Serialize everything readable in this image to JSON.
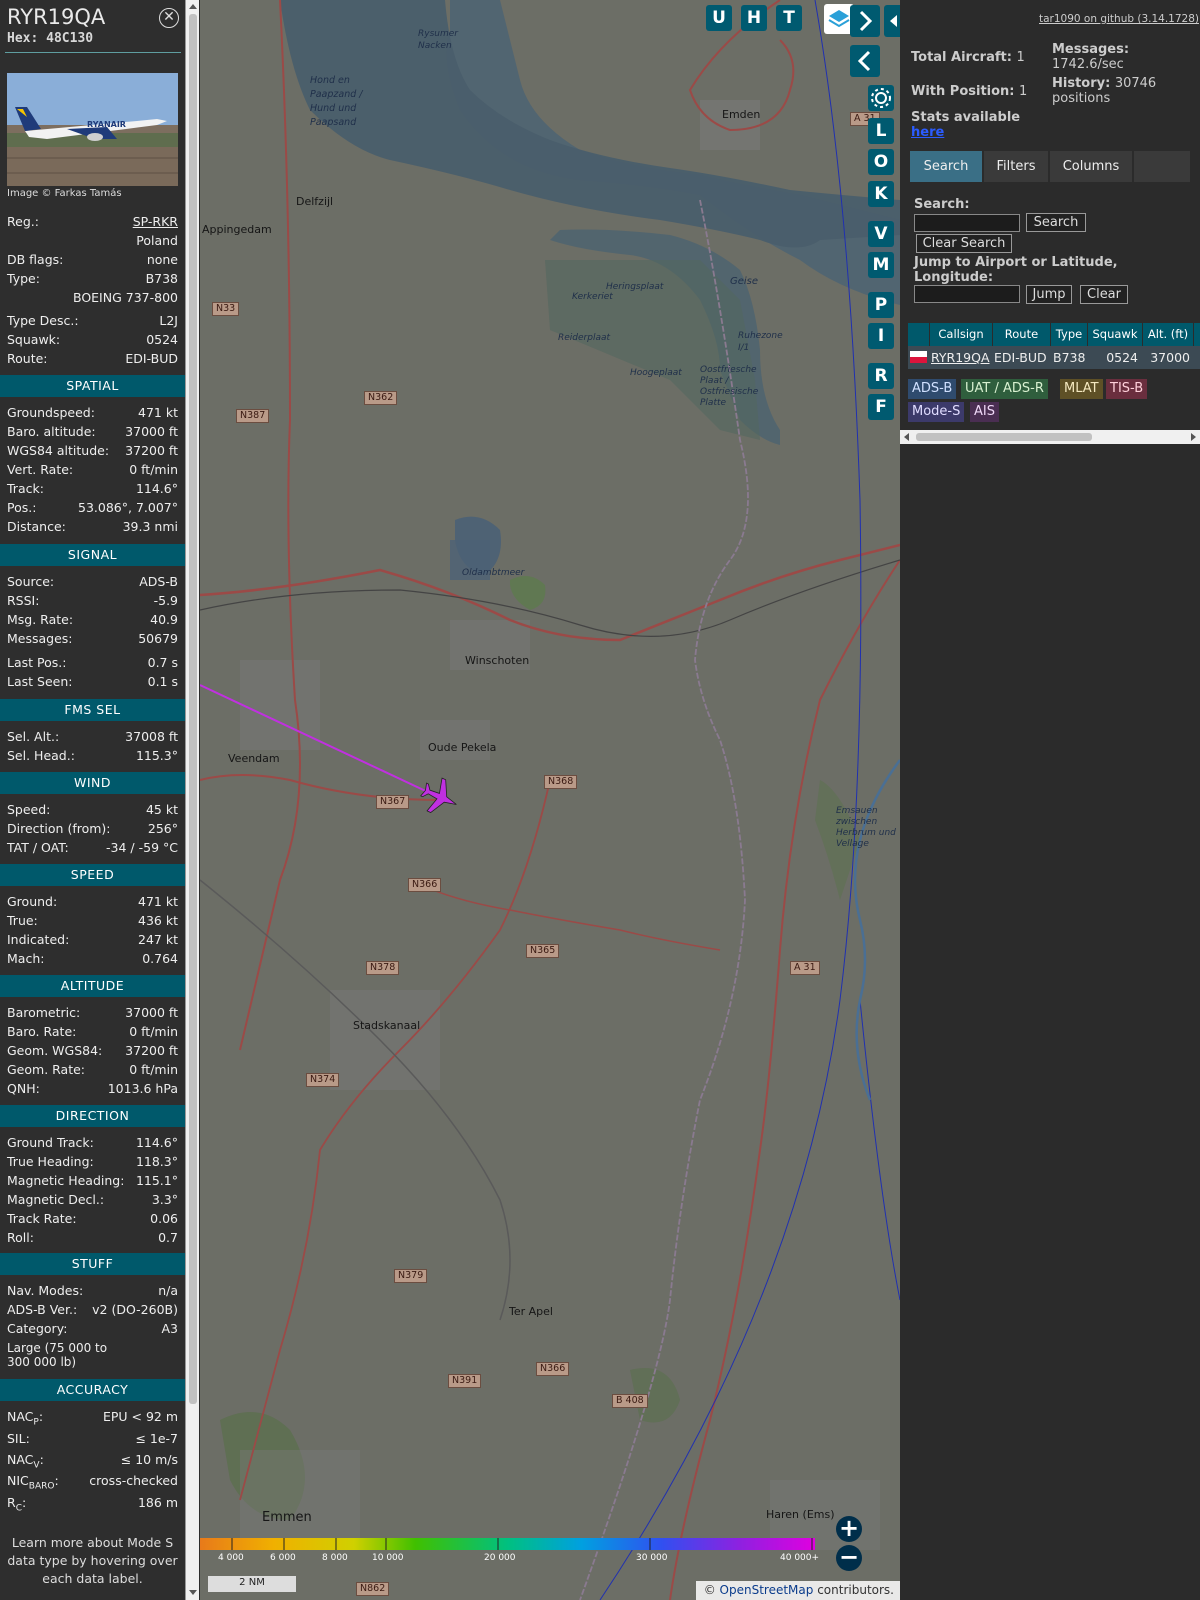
{
  "aircraft": {
    "callsign": "RYR19QA",
    "hex_label": "Hex:",
    "hex": "48C130",
    "photo_caption": "Image © Farkas Tamás",
    "photo_livery": "RYANAIR"
  },
  "info_rows": [
    {
      "k": "Reg.:",
      "v": "SP-RKR",
      "sub": "Poland"
    },
    {
      "k": "DB flags:",
      "v": "none"
    },
    {
      "k": "Type:",
      "v": "B738",
      "sub": "BOEING 737-800"
    },
    {
      "k": "Type Desc.:",
      "v": "L2J"
    },
    {
      "k": "Squawk:",
      "v": "0524"
    },
    {
      "k": "Route:",
      "v": "EDI-BUD"
    }
  ],
  "sections": {
    "spatial": "SPATIAL",
    "signal": "SIGNAL",
    "fms": "FMS SEL",
    "wind": "WIND",
    "speed": "SPEED",
    "altitude": "ALTITUDE",
    "direction": "DIRECTION",
    "stuff": "STUFF",
    "accuracy": "ACCURACY"
  },
  "spatial": [
    {
      "k": "Groundspeed:",
      "v": "471 kt"
    },
    {
      "k": "Baro. altitude:",
      "v": "37000 ft"
    },
    {
      "k": "WGS84 altitude:",
      "v": "37200 ft"
    },
    {
      "k": "Vert. Rate:",
      "v": "0 ft/min"
    },
    {
      "k": "Track:",
      "v": "114.6°"
    },
    {
      "k": "Pos.:",
      "v": "53.086°, 7.007°"
    },
    {
      "k": "Distance:",
      "v": "39.3 nmi"
    }
  ],
  "signal": [
    {
      "k": "Source:",
      "v": "ADS-B"
    },
    {
      "k": "RSSI:",
      "v": "-5.9"
    },
    {
      "k": "Msg. Rate:",
      "v": "40.9"
    },
    {
      "k": "Messages:",
      "v": "50679"
    },
    {
      "k": "Last Pos.:",
      "v": "0.7 s"
    },
    {
      "k": "Last Seen:",
      "v": "0.1 s"
    }
  ],
  "fms": [
    {
      "k": "Sel. Alt.:",
      "v": "37008 ft"
    },
    {
      "k": "Sel. Head.:",
      "v": "115.3°"
    }
  ],
  "wind": [
    {
      "k": "Speed:",
      "v": "45 kt"
    },
    {
      "k": "Direction (from):",
      "v": "256°"
    },
    {
      "k": "TAT / OAT:",
      "v": "-34 / -59 °C"
    }
  ],
  "speed": [
    {
      "k": "Ground:",
      "v": "471 kt"
    },
    {
      "k": "True:",
      "v": "436 kt"
    },
    {
      "k": "Indicated:",
      "v": "247 kt"
    },
    {
      "k": "Mach:",
      "v": "0.764"
    }
  ],
  "altitude": [
    {
      "k": "Barometric:",
      "v": "37000 ft"
    },
    {
      "k": "Baro. Rate:",
      "v": "0 ft/min"
    },
    {
      "k": "Geom. WGS84:",
      "v": "37200 ft"
    },
    {
      "k": "Geom. Rate:",
      "v": "0 ft/min"
    },
    {
      "k": "QNH:",
      "v": "1013.6 hPa"
    }
  ],
  "direction": [
    {
      "k": "Ground Track:",
      "v": "114.6°"
    },
    {
      "k": "True Heading:",
      "v": "118.3°"
    },
    {
      "k": "Magnetic Heading:",
      "v": "115.1°"
    },
    {
      "k": "Magnetic Decl.:",
      "v": "3.3°"
    },
    {
      "k": "Track Rate:",
      "v": "0.06"
    },
    {
      "k": "Roll:",
      "v": "0.7"
    }
  ],
  "stuff": [
    {
      "k": "Nav. Modes:",
      "v": "n/a"
    },
    {
      "k": "ADS-B Ver.:",
      "v": "v2 (DO-260B)"
    },
    {
      "k": "Category:",
      "v": "A3"
    }
  ],
  "stuff_category_desc": "Large (75 000 to 300 000 lb)",
  "accuracy": [
    {
      "k": "NAC",
      "sub": "P",
      "tail": ":",
      "v": "EPU < 92 m"
    },
    {
      "k": "SIL:",
      "sub": "",
      "tail": "",
      "v": "≤ 1e-7"
    },
    {
      "k": "NAC",
      "sub": "V",
      "tail": ":",
      "v": "≤ 10 m/s"
    },
    {
      "k": "NIC",
      "sub": "BARO",
      "tail": ":",
      "v": "cross-checked"
    },
    {
      "k": "R",
      "sub": "C",
      "tail": ":",
      "v": "186 m"
    }
  ],
  "footer_note": "Learn more about Mode S data type by hovering over each data label.",
  "map": {
    "buttons_top": [
      "U",
      "H",
      "T"
    ],
    "side_buttons": [
      "L",
      "O",
      "K",
      "V",
      "M",
      "P",
      "I",
      "R",
      "F"
    ],
    "places": [
      {
        "n": "Emden"
      },
      {
        "n": "Delfzijl"
      },
      {
        "n": "Appingedam"
      },
      {
        "n": "Winschoten"
      },
      {
        "n": "Oude Pekela"
      },
      {
        "n": "Veendam"
      },
      {
        "n": "Stadskanaal"
      },
      {
        "n": "Ter Apel"
      },
      {
        "n": "Emmen"
      },
      {
        "n": "Haren (Ems)"
      },
      {
        "n": "Oldambtmeer"
      },
      {
        "n": "Geise"
      },
      {
        "n": "Rysumer Nacken"
      },
      {
        "n": "Hond en Paapzand / Hund und Paapsand"
      },
      {
        "n": "Ruhezone I/1"
      },
      {
        "n": "Heringsplaat"
      },
      {
        "n": "Kerkeriet"
      },
      {
        "n": "Reiderplaat"
      },
      {
        "n": "Hoogeplaat"
      },
      {
        "n": "Oostfriesche Plaat / Ostfriesische Platte"
      },
      {
        "n": "Emsauen zwischen Herbrum und Vellage"
      }
    ],
    "roads": [
      "N33",
      "N387",
      "N362",
      "N367",
      "N368",
      "N366",
      "N365",
      "N378",
      "N374",
      "N379",
      "N391",
      "N366",
      "N862",
      "A 31",
      "A 31",
      "B 408"
    ],
    "altitude_scale": [
      "4 000",
      "6 000",
      "8 000",
      "10 000",
      "20 000",
      "30 000",
      "40 000+"
    ],
    "scale_bar": "2 NM",
    "attribution_prefix": "© ",
    "attribution_link": "OpenStreetMap",
    "attribution_suffix": " contributors."
  },
  "right": {
    "github": "tar1090 on github (3.14.1728)",
    "total_label": "Total Aircraft:",
    "total": "1",
    "pos_label": "With Position:",
    "pos": "1",
    "msg_label": "Messages:",
    "msg": "1742.6/sec",
    "hist_label": "History:",
    "hist": "30746 positions",
    "stats_label": "Stats available",
    "stats_link": "here",
    "tabs": [
      "Search",
      "Filters",
      "Columns"
    ],
    "search_label": "Search:",
    "search_btn": "Search",
    "clear_search": "Clear Search",
    "jump_label": "Jump to Airport or Latitude, Longitude:",
    "jump_btn": "Jump",
    "clear_btn": "Clear",
    "columns": [
      "Callsign",
      "Route",
      "Type",
      "Squawk",
      "Alt. (ft)"
    ],
    "row": {
      "callsign": "RYR19QA",
      "route": "EDI-BUD",
      "type": "B738",
      "squawk": "0524",
      "alt": "37000"
    },
    "legend": [
      {
        "n": "ADS-B",
        "bg": "#2f4b6e",
        "fg": "#d0e0ff"
      },
      {
        "n": "UAT / ADS-R",
        "bg": "#2f5e3d",
        "fg": "#d8f0d0"
      },
      {
        "n": "MLAT",
        "bg": "#5e5026",
        "fg": "#f4e8c0"
      },
      {
        "n": "TIS-B",
        "bg": "#6a2e3e",
        "fg": "#ffd0da"
      },
      {
        "n": "Mode-S",
        "bg": "#3c3a6a",
        "fg": "#e0dcff"
      },
      {
        "n": "AIS",
        "bg": "#4a2e52",
        "fg": "#f0d8f8"
      }
    ]
  }
}
